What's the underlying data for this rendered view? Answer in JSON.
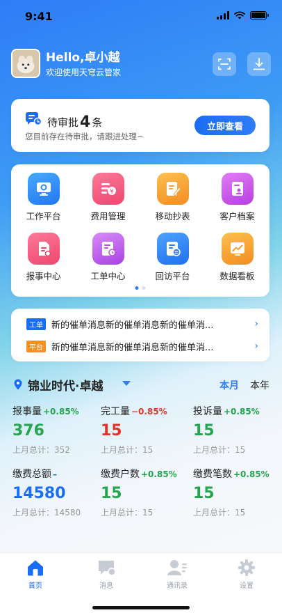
{
  "status_bar": {
    "time": "9:41"
  },
  "header": {
    "greeting": "Hello,卓小越",
    "subtitle": "欢迎使用天穹云管家"
  },
  "pending": {
    "prefix": "待审批",
    "count": "4",
    "suffix": "条",
    "description": "您目前存在待审批，请跟进处理~",
    "button": "立即查看"
  },
  "menu": [
    {
      "label": "工作平台",
      "icon": "workbench-icon",
      "color": "#2e8cf6"
    },
    {
      "label": "费用管理",
      "icon": "fee-icon",
      "color": "#f4577a"
    },
    {
      "label": "移动抄表",
      "icon": "meter-icon",
      "color": "#f7a132"
    },
    {
      "label": "客户档案",
      "icon": "customer-file-icon",
      "color": "#c94ee4"
    },
    {
      "label": "报事中心",
      "icon": "report-icon",
      "color": "#f4577a"
    },
    {
      "label": "工单中心",
      "icon": "work-order-icon",
      "color": "#c24fe8"
    },
    {
      "label": "回访平台",
      "icon": "return-visit-icon",
      "color": "#2e7ff6"
    },
    {
      "label": "数据看板",
      "icon": "dashboard-icon",
      "color": "#f7a132"
    }
  ],
  "notices": [
    {
      "tag": "工单",
      "tag_color": "#1a6df5",
      "text": "新的催单消息新的催单消息新的催单消..."
    },
    {
      "tag": "平台",
      "tag_color": "#f5921f",
      "text": "新的催单消息新的催单消息新的催单消..."
    }
  ],
  "project": {
    "name": "锦业时代·卓越",
    "period_month": "本月",
    "period_year": "本年"
  },
  "stats": [
    {
      "name": "报事量",
      "pct": "+0.85%",
      "pct_class": "c-green",
      "value": "376",
      "value_class": "c-green",
      "last": "上月总计：352"
    },
    {
      "name": "完工量",
      "pct": "−0.85%",
      "pct_class": "c-red",
      "value": "15",
      "value_class": "c-red",
      "last": "上月总计：15"
    },
    {
      "name": "投诉量",
      "pct": "+0.85%",
      "pct_class": "c-green",
      "value": "15",
      "value_class": "c-green",
      "last": "上月总计：15"
    },
    {
      "name": "缴费总额",
      "pct": "–",
      "pct_class": "c-dash",
      "value": "14580",
      "value_class": "c-blue",
      "last": "上月总计：14580"
    },
    {
      "name": "缴费户数",
      "pct": "+0.85%",
      "pct_class": "c-green",
      "value": "15",
      "value_class": "c-green",
      "last": "上月总计：15"
    },
    {
      "name": "缴费笔数",
      "pct": "+0.85%",
      "pct_class": "c-green",
      "value": "15",
      "value_class": "c-green",
      "last": "上月总计：15"
    }
  ],
  "tabs": [
    {
      "label": "首页",
      "icon": "home-icon",
      "active": true
    },
    {
      "label": "消息",
      "icon": "message-icon",
      "active": false
    },
    {
      "label": "通讯录",
      "icon": "contacts-icon",
      "active": false
    },
    {
      "label": "设置",
      "icon": "settings-icon",
      "active": false
    }
  ]
}
